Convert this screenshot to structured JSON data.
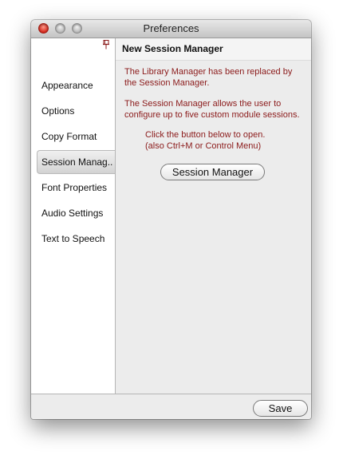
{
  "window": {
    "title": "Preferences"
  },
  "sidebar": {
    "items": [
      {
        "label": "Appearance"
      },
      {
        "label": "Options"
      },
      {
        "label": "Copy Format"
      },
      {
        "label": "Session Manag.."
      },
      {
        "label": "Font Properties"
      },
      {
        "label": "Audio Settings"
      },
      {
        "label": "Text to Speech"
      }
    ],
    "selected": "Session Manag.."
  },
  "content": {
    "title": "New Session Manager",
    "line1": "The Library Manager has been replaced by",
    "line2": "the Session Manager.",
    "line3": "The Session Manager allows the user to",
    "line4": "configure up to five custom module sessions.",
    "line5": "Click the button below to open.",
    "line6": "(also Ctrl+M or Control Menu)",
    "button_label": "Session Manager"
  },
  "footer": {
    "save_label": "Save"
  },
  "colors": {
    "message_text": "#8b1a1a",
    "close_button": "#d52a1e"
  },
  "icons": {
    "pin": "pushpin-icon"
  }
}
